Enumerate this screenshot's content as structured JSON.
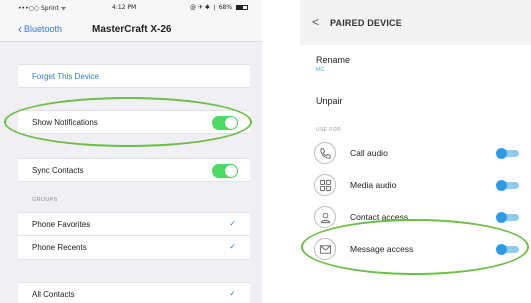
{
  "ios": {
    "status": {
      "carrier": "•••○○ Sprint ᯤ",
      "time": "4:12 PM",
      "battery": "@ ✈ ✱ ❘ 68%"
    },
    "nav": {
      "back_label": "Bluetooth",
      "title": "MasterCraft X-26"
    },
    "forget_label": "Forget This Device",
    "show_notifications": {
      "label": "Show Notifications",
      "enabled": true
    },
    "sync_contacts": {
      "label": "Sync Contacts",
      "enabled": true
    },
    "groups_header": "GROUPS",
    "groups": [
      {
        "label": "Phone Favorites",
        "checked": true
      },
      {
        "label": "Phone Recents",
        "checked": true
      },
      {
        "label": "All Contacts",
        "checked": true
      }
    ],
    "accent_color": "#3478d6",
    "toggle_color": "#4cd964"
  },
  "android": {
    "header": {
      "back_glyph": "<",
      "title": "PAIRED DEVICE"
    },
    "rename": {
      "label": "Rename",
      "value": "MC"
    },
    "unpair_label": "Unpair",
    "use_for_header": "USE FOR",
    "rows": [
      {
        "icon": "phone-icon",
        "label": "Call audio",
        "enabled": true
      },
      {
        "icon": "media-icon",
        "label": "Media audio",
        "enabled": true
      },
      {
        "icon": "contact-icon",
        "label": "Contact access",
        "enabled": true
      },
      {
        "icon": "message-icon",
        "label": "Message access",
        "enabled": true
      }
    ],
    "accent_color": "#2f9be6"
  },
  "highlight_color": "#6cbe45"
}
